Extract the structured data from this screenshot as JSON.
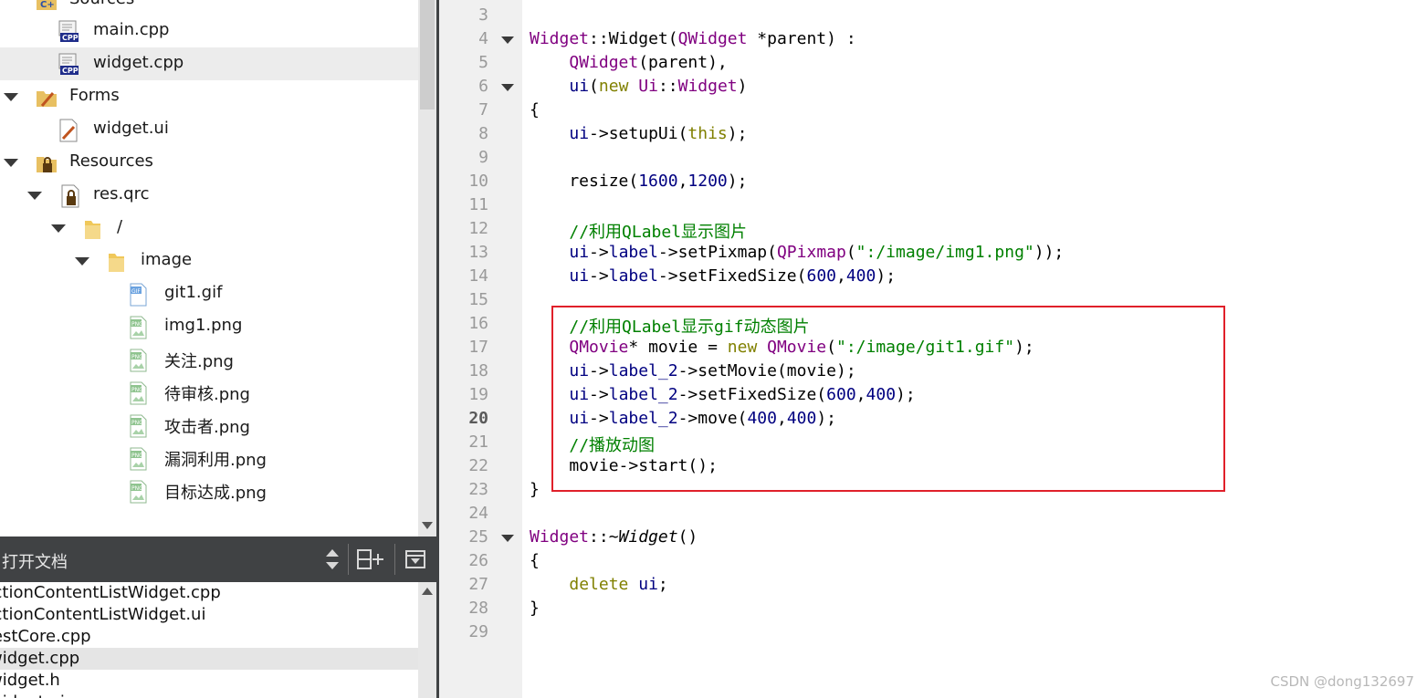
{
  "project_tree": {
    "items": [
      {
        "label": "Sources",
        "kind": "cpp-folder",
        "expanded": true
      },
      {
        "label": "main.cpp",
        "kind": "cpp-file"
      },
      {
        "label": "widget.cpp",
        "kind": "cpp-file",
        "selected": true
      },
      {
        "label": "Forms",
        "kind": "forms-folder",
        "expanded": true
      },
      {
        "label": "widget.ui",
        "kind": "ui-file"
      },
      {
        "label": "Resources",
        "kind": "resource-folder",
        "expanded": true
      },
      {
        "label": "res.qrc",
        "kind": "qrc-file",
        "expanded": true
      },
      {
        "label": "/",
        "kind": "folder",
        "expanded": true
      },
      {
        "label": "image",
        "kind": "folder",
        "expanded": true
      },
      {
        "label": "git1.gif",
        "kind": "gif-file"
      },
      {
        "label": "img1.png",
        "kind": "png-file"
      },
      {
        "label": "关注.png",
        "kind": "png-file"
      },
      {
        "label": "待审核.png",
        "kind": "png-file"
      },
      {
        "label": "攻击者.png",
        "kind": "png-file"
      },
      {
        "label": "漏洞利用.png",
        "kind": "png-file"
      },
      {
        "label": "目标达成.png",
        "kind": "png-file"
      }
    ]
  },
  "open_documents": {
    "title": "打开文档",
    "items": [
      {
        "label": "SectionContentListWidget.cpp"
      },
      {
        "label": "SectionContentListWidget.ui"
      },
      {
        "label": "TestCore.cpp"
      },
      {
        "label": "widget.cpp",
        "selected": true
      },
      {
        "label": "widget.h"
      },
      {
        "label": "widget.ui"
      }
    ]
  },
  "editor": {
    "current_line": "20",
    "lines": [
      {
        "num": "3",
        "tokens": []
      },
      {
        "num": "4",
        "fold": true,
        "tokens": [
          {
            "t": "Widget",
            "c": "ty"
          },
          {
            "t": "::",
            "c": ""
          },
          {
            "t": "Widget",
            "c": ""
          },
          {
            "t": "(",
            "c": ""
          },
          {
            "t": "QWidget",
            "c": "ty"
          },
          {
            "t": " *parent) :",
            "c": ""
          }
        ]
      },
      {
        "num": "5",
        "tokens": [
          {
            "t": "    ",
            "c": ""
          },
          {
            "t": "QWidget",
            "c": "ty"
          },
          {
            "t": "(parent),",
            "c": ""
          }
        ]
      },
      {
        "num": "6",
        "fold": true,
        "tokens": [
          {
            "t": "    ",
            "c": ""
          },
          {
            "t": "ui",
            "c": "ls"
          },
          {
            "t": "(",
            "c": ""
          },
          {
            "t": "new",
            "c": "kw"
          },
          {
            "t": " ",
            "c": ""
          },
          {
            "t": "Ui",
            "c": "ty"
          },
          {
            "t": "::",
            "c": ""
          },
          {
            "t": "Widget",
            "c": "ty"
          },
          {
            "t": ")",
            "c": ""
          }
        ]
      },
      {
        "num": "7",
        "tokens": [
          {
            "t": "{",
            "c": ""
          }
        ]
      },
      {
        "num": "8",
        "tokens": [
          {
            "t": "    ",
            "c": ""
          },
          {
            "t": "ui",
            "c": "ls"
          },
          {
            "t": "->setupUi(",
            "c": ""
          },
          {
            "t": "this",
            "c": "kw"
          },
          {
            "t": ");",
            "c": ""
          }
        ]
      },
      {
        "num": "9",
        "tokens": []
      },
      {
        "num": "10",
        "tokens": [
          {
            "t": "    resize(",
            "c": ""
          },
          {
            "t": "1600",
            "c": "nm"
          },
          {
            "t": ",",
            "c": ""
          },
          {
            "t": "1200",
            "c": "nm"
          },
          {
            "t": ");",
            "c": ""
          }
        ]
      },
      {
        "num": "11",
        "tokens": []
      },
      {
        "num": "12",
        "tokens": [
          {
            "t": "    ",
            "c": ""
          },
          {
            "t": "//利用QLabel显示图片",
            "c": "cm"
          }
        ]
      },
      {
        "num": "13",
        "tokens": [
          {
            "t": "    ",
            "c": ""
          },
          {
            "t": "ui",
            "c": "ls"
          },
          {
            "t": "->",
            "c": ""
          },
          {
            "t": "label",
            "c": "ls"
          },
          {
            "t": "->setPixmap(",
            "c": ""
          },
          {
            "t": "QPixmap",
            "c": "ty"
          },
          {
            "t": "(",
            "c": ""
          },
          {
            "t": "\":/image/img1.png\"",
            "c": "st"
          },
          {
            "t": "));",
            "c": ""
          }
        ]
      },
      {
        "num": "14",
        "tokens": [
          {
            "t": "    ",
            "c": ""
          },
          {
            "t": "ui",
            "c": "ls"
          },
          {
            "t": "->",
            "c": ""
          },
          {
            "t": "label",
            "c": "ls"
          },
          {
            "t": "->setFixedSize(",
            "c": ""
          },
          {
            "t": "600",
            "c": "nm"
          },
          {
            "t": ",",
            "c": ""
          },
          {
            "t": "400",
            "c": "nm"
          },
          {
            "t": ");",
            "c": ""
          }
        ]
      },
      {
        "num": "15",
        "tokens": []
      },
      {
        "num": "16",
        "tokens": [
          {
            "t": "    ",
            "c": ""
          },
          {
            "t": "//利用QLabel显示gif动态图片",
            "c": "cm"
          }
        ]
      },
      {
        "num": "17",
        "tokens": [
          {
            "t": "    ",
            "c": ""
          },
          {
            "t": "QMovie",
            "c": "ty"
          },
          {
            "t": "* movie = ",
            "c": ""
          },
          {
            "t": "new",
            "c": "kw"
          },
          {
            "t": " ",
            "c": ""
          },
          {
            "t": "QMovie",
            "c": "ty"
          },
          {
            "t": "(",
            "c": ""
          },
          {
            "t": "\":/image/git1.gif\"",
            "c": "st"
          },
          {
            "t": ");",
            "c": ""
          }
        ]
      },
      {
        "num": "18",
        "tokens": [
          {
            "t": "    ",
            "c": ""
          },
          {
            "t": "ui",
            "c": "ls"
          },
          {
            "t": "->",
            "c": ""
          },
          {
            "t": "label_2",
            "c": "ls"
          },
          {
            "t": "->setMovie(movie);",
            "c": ""
          }
        ]
      },
      {
        "num": "19",
        "tokens": [
          {
            "t": "    ",
            "c": ""
          },
          {
            "t": "ui",
            "c": "ls"
          },
          {
            "t": "->",
            "c": ""
          },
          {
            "t": "label_2",
            "c": "ls"
          },
          {
            "t": "->setFixedSize(",
            "c": ""
          },
          {
            "t": "600",
            "c": "nm"
          },
          {
            "t": ",",
            "c": ""
          },
          {
            "t": "400",
            "c": "nm"
          },
          {
            "t": ");",
            "c": ""
          }
        ]
      },
      {
        "num": "20",
        "tokens": [
          {
            "t": "    ",
            "c": ""
          },
          {
            "t": "ui",
            "c": "ls"
          },
          {
            "t": "->",
            "c": ""
          },
          {
            "t": "label_2",
            "c": "ls"
          },
          {
            "t": "->move(",
            "c": ""
          },
          {
            "t": "400",
            "c": "nm"
          },
          {
            "t": ",",
            "c": ""
          },
          {
            "t": "400",
            "c": "nm"
          },
          {
            "t": ");",
            "c": ""
          }
        ]
      },
      {
        "num": "21",
        "tokens": [
          {
            "t": "    ",
            "c": ""
          },
          {
            "t": "//播放动图",
            "c": "cm"
          }
        ]
      },
      {
        "num": "22",
        "tokens": [
          {
            "t": "    movie->start();",
            "c": ""
          }
        ]
      },
      {
        "num": "23",
        "tokens": [
          {
            "t": "}",
            "c": ""
          }
        ]
      },
      {
        "num": "24",
        "tokens": []
      },
      {
        "num": "25",
        "fold": true,
        "tokens": [
          {
            "t": "Widget",
            "c": "ty"
          },
          {
            "t": "::",
            "c": ""
          },
          {
            "t": "~Widget",
            "c": "it"
          },
          {
            "t": "()",
            "c": ""
          }
        ]
      },
      {
        "num": "26",
        "tokens": [
          {
            "t": "{",
            "c": ""
          }
        ]
      },
      {
        "num": "27",
        "tokens": [
          {
            "t": "    ",
            "c": ""
          },
          {
            "t": "delete",
            "c": "kw"
          },
          {
            "t": " ",
            "c": ""
          },
          {
            "t": "ui",
            "c": "ls"
          },
          {
            "t": ";",
            "c": ""
          }
        ]
      },
      {
        "num": "28",
        "tokens": [
          {
            "t": "}",
            "c": ""
          }
        ]
      },
      {
        "num": "29",
        "tokens": []
      }
    ]
  },
  "watermark": "CSDN @dong132697",
  "colors": {
    "type": "#800080",
    "member": "#000080",
    "keyword": "#808000",
    "number": "#000080",
    "string": "#008000",
    "comment": "#008000",
    "highlight_box": "#e0202a",
    "change_bar": "#1f9d1f",
    "pane_header": "#404244"
  }
}
